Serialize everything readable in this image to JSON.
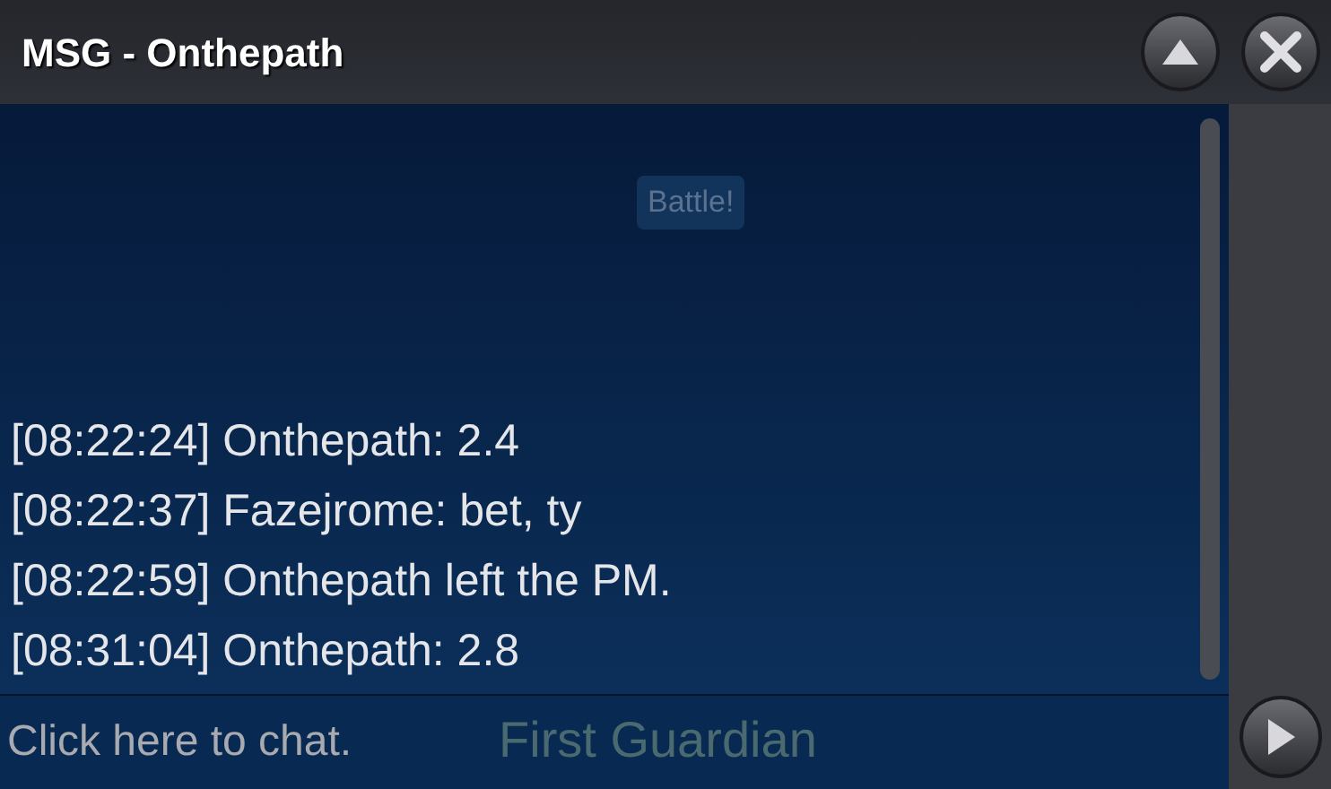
{
  "window": {
    "title": "MSG - Onthepath"
  },
  "messages": [
    {
      "time": "[08:22:24]",
      "text": "Onthepath: 2.4"
    },
    {
      "time": "[08:22:37]",
      "text": "Fazejrome: bet, ty"
    },
    {
      "time": "[08:22:59]",
      "text": "Onthepath left the PM."
    },
    {
      "time": "[08:31:04]",
      "text": "Onthepath: 2.8"
    }
  ],
  "background_texts": {
    "tooltip": "Battle!",
    "name": "First Guardian"
  },
  "chat_input": {
    "placeholder": "Click here to chat."
  }
}
